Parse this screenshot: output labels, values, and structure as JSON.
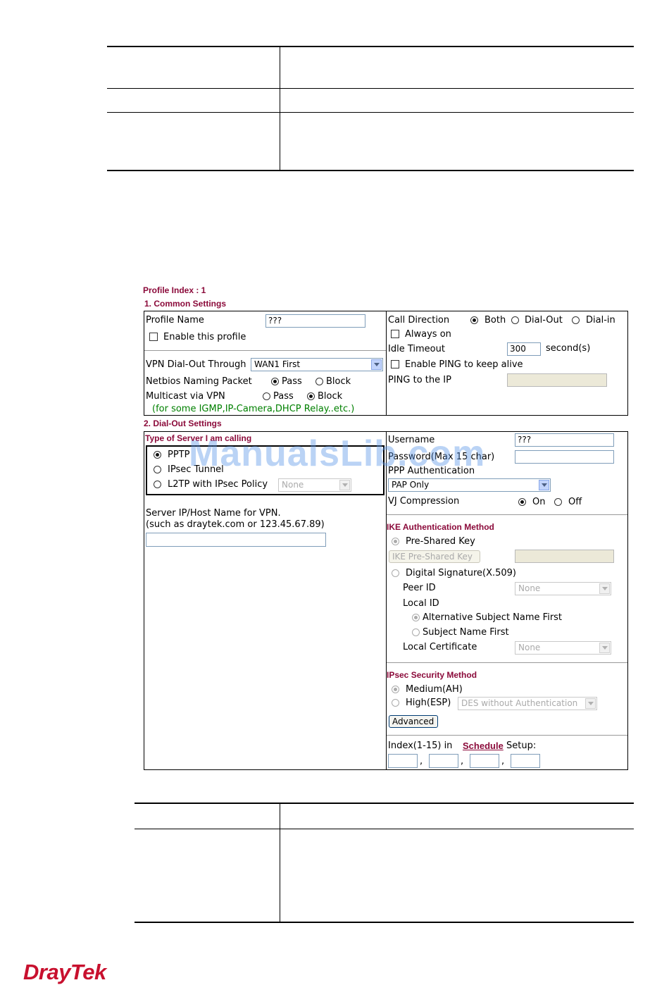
{
  "profile": {
    "index_label": "Profile Index : 1"
  },
  "common": {
    "heading": "1. Common Settings",
    "profile_name_label": "Profile Name",
    "profile_name_value": "???",
    "enable_profile_label": "Enable this profile",
    "vpn_dialout_label": "VPN Dial-Out Through",
    "vpn_dialout_value": "WAN1 First",
    "netbios_label": "Netbios Naming Packet",
    "pass_label": "Pass",
    "block_label": "Block",
    "multicast_label": "Multicast via VPN",
    "multicast_note": "(for some IGMP,IP-Camera,DHCP Relay..etc.)",
    "call_direction_label": "Call Direction",
    "both_label": "Both",
    "dialout_label": "Dial-Out",
    "dialin_label": "Dial-in",
    "always_on_label": "Always on",
    "idle_timeout_label": "Idle Timeout",
    "idle_timeout_value": "300",
    "seconds_label": "second(s)",
    "enable_ping_label": "Enable PING to keep alive",
    "ping_ip_label": "PING to the IP"
  },
  "dialout": {
    "heading": "2. Dial-Out Settings",
    "server_type_heading": "Type of Server I am calling",
    "pptp_label": "PPTP",
    "ipsec_label": "IPsec Tunnel",
    "l2tp_label": "L2TP with IPsec Policy",
    "l2tp_policy_value": "None",
    "server_ip_label": "Server IP/Host Name for VPN.",
    "server_ip_hint": "(such as draytek.com or 123.45.67.89)",
    "username_label": "Username",
    "username_value": "???",
    "password_label": "Password(Max 15 char)",
    "ppp_auth_label": "PPP Authentication",
    "ppp_auth_value": "PAP Only",
    "vj_label": "VJ Compression",
    "on_label": "On",
    "off_label": "Off",
    "ike_heading": "IKE Authentication Method",
    "psk_label": "Pre-Shared Key",
    "ike_psk_button": "IKE Pre-Shared Key",
    "digsig_label": "Digital Signature(X.509)",
    "peer_id_label": "Peer ID",
    "peer_id_value": "None",
    "local_id_label": "Local ID",
    "alt_subject_label": "Alternative Subject Name First",
    "subject_label": "Subject Name First",
    "local_cert_label": "Local Certificate",
    "local_cert_value": "None",
    "ipsec_heading": "IPsec Security Method",
    "medium_label": "Medium(AH)",
    "high_label": "High(ESP)",
    "high_value": "DES without Authentication",
    "advanced_button": "Advanced",
    "index_label": "Index(1-15) in",
    "schedule_link": "Schedule",
    "setup_label": "Setup:",
    "comma": ","
  },
  "watermark": "ManualsLib.com",
  "logo": "DrayTek"
}
